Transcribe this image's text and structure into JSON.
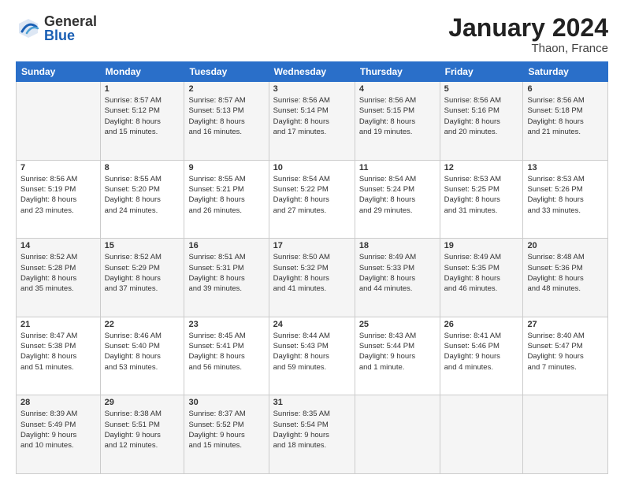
{
  "logo": {
    "general": "General",
    "blue": "Blue"
  },
  "title": "January 2024",
  "location": "Thaon, France",
  "days_of_week": [
    "Sunday",
    "Monday",
    "Tuesday",
    "Wednesday",
    "Thursday",
    "Friday",
    "Saturday"
  ],
  "weeks": [
    [
      {
        "day": "",
        "info": ""
      },
      {
        "day": "1",
        "info": "Sunrise: 8:57 AM\nSunset: 5:12 PM\nDaylight: 8 hours\nand 15 minutes."
      },
      {
        "day": "2",
        "info": "Sunrise: 8:57 AM\nSunset: 5:13 PM\nDaylight: 8 hours\nand 16 minutes."
      },
      {
        "day": "3",
        "info": "Sunrise: 8:56 AM\nSunset: 5:14 PM\nDaylight: 8 hours\nand 17 minutes."
      },
      {
        "day": "4",
        "info": "Sunrise: 8:56 AM\nSunset: 5:15 PM\nDaylight: 8 hours\nand 19 minutes."
      },
      {
        "day": "5",
        "info": "Sunrise: 8:56 AM\nSunset: 5:16 PM\nDaylight: 8 hours\nand 20 minutes."
      },
      {
        "day": "6",
        "info": "Sunrise: 8:56 AM\nSunset: 5:18 PM\nDaylight: 8 hours\nand 21 minutes."
      }
    ],
    [
      {
        "day": "7",
        "info": "Sunrise: 8:56 AM\nSunset: 5:19 PM\nDaylight: 8 hours\nand 23 minutes."
      },
      {
        "day": "8",
        "info": "Sunrise: 8:55 AM\nSunset: 5:20 PM\nDaylight: 8 hours\nand 24 minutes."
      },
      {
        "day": "9",
        "info": "Sunrise: 8:55 AM\nSunset: 5:21 PM\nDaylight: 8 hours\nand 26 minutes."
      },
      {
        "day": "10",
        "info": "Sunrise: 8:54 AM\nSunset: 5:22 PM\nDaylight: 8 hours\nand 27 minutes."
      },
      {
        "day": "11",
        "info": "Sunrise: 8:54 AM\nSunset: 5:24 PM\nDaylight: 8 hours\nand 29 minutes."
      },
      {
        "day": "12",
        "info": "Sunrise: 8:53 AM\nSunset: 5:25 PM\nDaylight: 8 hours\nand 31 minutes."
      },
      {
        "day": "13",
        "info": "Sunrise: 8:53 AM\nSunset: 5:26 PM\nDaylight: 8 hours\nand 33 minutes."
      }
    ],
    [
      {
        "day": "14",
        "info": "Sunrise: 8:52 AM\nSunset: 5:28 PM\nDaylight: 8 hours\nand 35 minutes."
      },
      {
        "day": "15",
        "info": "Sunrise: 8:52 AM\nSunset: 5:29 PM\nDaylight: 8 hours\nand 37 minutes."
      },
      {
        "day": "16",
        "info": "Sunrise: 8:51 AM\nSunset: 5:31 PM\nDaylight: 8 hours\nand 39 minutes."
      },
      {
        "day": "17",
        "info": "Sunrise: 8:50 AM\nSunset: 5:32 PM\nDaylight: 8 hours\nand 41 minutes."
      },
      {
        "day": "18",
        "info": "Sunrise: 8:49 AM\nSunset: 5:33 PM\nDaylight: 8 hours\nand 44 minutes."
      },
      {
        "day": "19",
        "info": "Sunrise: 8:49 AM\nSunset: 5:35 PM\nDaylight: 8 hours\nand 46 minutes."
      },
      {
        "day": "20",
        "info": "Sunrise: 8:48 AM\nSunset: 5:36 PM\nDaylight: 8 hours\nand 48 minutes."
      }
    ],
    [
      {
        "day": "21",
        "info": "Sunrise: 8:47 AM\nSunset: 5:38 PM\nDaylight: 8 hours\nand 51 minutes."
      },
      {
        "day": "22",
        "info": "Sunrise: 8:46 AM\nSunset: 5:40 PM\nDaylight: 8 hours\nand 53 minutes."
      },
      {
        "day": "23",
        "info": "Sunrise: 8:45 AM\nSunset: 5:41 PM\nDaylight: 8 hours\nand 56 minutes."
      },
      {
        "day": "24",
        "info": "Sunrise: 8:44 AM\nSunset: 5:43 PM\nDaylight: 8 hours\nand 59 minutes."
      },
      {
        "day": "25",
        "info": "Sunrise: 8:43 AM\nSunset: 5:44 PM\nDaylight: 9 hours\nand 1 minute."
      },
      {
        "day": "26",
        "info": "Sunrise: 8:41 AM\nSunset: 5:46 PM\nDaylight: 9 hours\nand 4 minutes."
      },
      {
        "day": "27",
        "info": "Sunrise: 8:40 AM\nSunset: 5:47 PM\nDaylight: 9 hours\nand 7 minutes."
      }
    ],
    [
      {
        "day": "28",
        "info": "Sunrise: 8:39 AM\nSunset: 5:49 PM\nDaylight: 9 hours\nand 10 minutes."
      },
      {
        "day": "29",
        "info": "Sunrise: 8:38 AM\nSunset: 5:51 PM\nDaylight: 9 hours\nand 12 minutes."
      },
      {
        "day": "30",
        "info": "Sunrise: 8:37 AM\nSunset: 5:52 PM\nDaylight: 9 hours\nand 15 minutes."
      },
      {
        "day": "31",
        "info": "Sunrise: 8:35 AM\nSunset: 5:54 PM\nDaylight: 9 hours\nand 18 minutes."
      },
      {
        "day": "",
        "info": ""
      },
      {
        "day": "",
        "info": ""
      },
      {
        "day": "",
        "info": ""
      }
    ]
  ]
}
